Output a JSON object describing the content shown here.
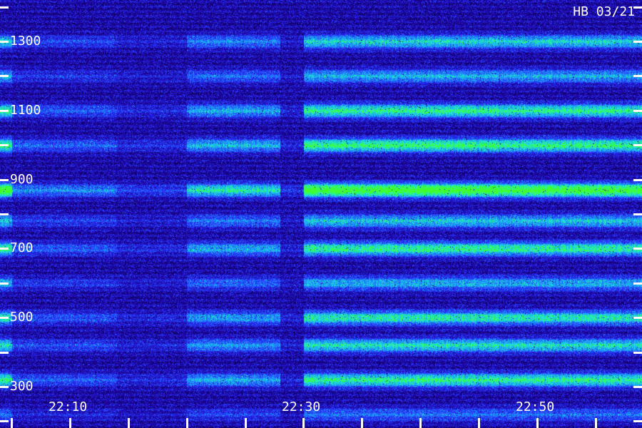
{
  "chart_data": {
    "type": "heatmap",
    "title": "",
    "stamp": "HB 03/21",
    "xlabel": "",
    "ylabel": "",
    "y_tick_labels": [
      "1300",
      "1100",
      "900",
      "700",
      "500",
      "300"
    ],
    "y_tick_values": [
      1300,
      1100,
      900,
      700,
      500,
      300
    ],
    "y_minor_tick_values": [
      1400,
      1200,
      1000,
      800,
      600,
      400,
      200
    ],
    "ylim": [
      180,
      1420
    ],
    "x_tick_labels": [
      "22:10",
      "22:30",
      "22:50"
    ],
    "x_tick_values": [
      "22:10",
      "22:30",
      "22:50"
    ],
    "x_minor_tick_values": [
      "22:05",
      "22:10",
      "22:15",
      "22:20",
      "22:25",
      "22:30",
      "22:35",
      "22:40",
      "22:45",
      "22:50",
      "22:55"
    ],
    "xlim": [
      "22:04",
      "22:59"
    ],
    "colormap": [
      "#000000",
      "#1a0090",
      "#2a30ff",
      "#1aa0ff",
      "#20f0c0",
      "#40ff30"
    ],
    "bands": [
      {
        "y": 1300,
        "strength": 0.55
      },
      {
        "y": 1200,
        "strength": 0.45
      },
      {
        "y": 1100,
        "strength": 0.7
      },
      {
        "y": 1000,
        "strength": 0.75
      },
      {
        "y": 870,
        "strength": 1.0
      },
      {
        "y": 780,
        "strength": 0.5
      },
      {
        "y": 700,
        "strength": 0.7
      },
      {
        "y": 600,
        "strength": 0.45
      },
      {
        "y": 500,
        "strength": 0.65
      },
      {
        "y": 420,
        "strength": 0.6
      },
      {
        "y": 320,
        "strength": 0.7
      },
      {
        "y": 220,
        "strength": 0.3
      }
    ],
    "segments": [
      {
        "from": "22:04",
        "to": "22:05",
        "intensity": 0.95
      },
      {
        "from": "22:05",
        "to": "22:14",
        "intensity": 0.35
      },
      {
        "from": "22:14",
        "to": "22:20",
        "intensity": 0.18
      },
      {
        "from": "22:20",
        "to": "22:28",
        "intensity": 0.6
      },
      {
        "from": "22:28",
        "to": "22:30",
        "intensity": 0.15
      },
      {
        "from": "22:30",
        "to": "22:59",
        "intensity": 0.95
      }
    ]
  }
}
